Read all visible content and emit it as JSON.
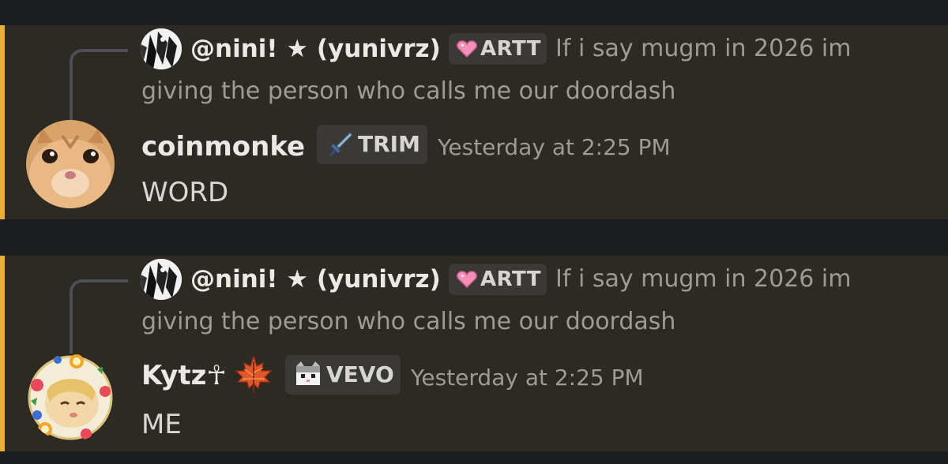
{
  "messages": [
    {
      "reply": {
        "author": "@nini! ★ (yunivrz)",
        "tag": "ARTT",
        "tag_icon": "pink-heart-icon",
        "text_line1": "If i say mugm in 2026 im",
        "text_line2": "giving the person who calls me our doordash"
      },
      "author": "coinmonke",
      "tag": "TRIM",
      "tag_icon": "sword-icon",
      "timestamp": "Yesterday at 2:25 PM",
      "content": "WORD",
      "avatar": "cat-avatar",
      "mention_color": "#e8b037"
    },
    {
      "reply": {
        "author": "@nini! ★ (yunivrz)",
        "tag": "ARTT",
        "tag_icon": "pink-heart-icon",
        "text_line1": "If i say mugm in 2026 im",
        "text_line2": "giving the person who calls me our doordash"
      },
      "author": "Kytz☥",
      "author_emoji": "maple-leaf-icon",
      "tag": "VEVO",
      "tag_icon": "pixel-cat-icon",
      "timestamp": "Yesterday at 2:25 PM",
      "content": "ME",
      "avatar": "anime-fruit-avatar",
      "mention_color": "#e8b037"
    }
  ]
}
